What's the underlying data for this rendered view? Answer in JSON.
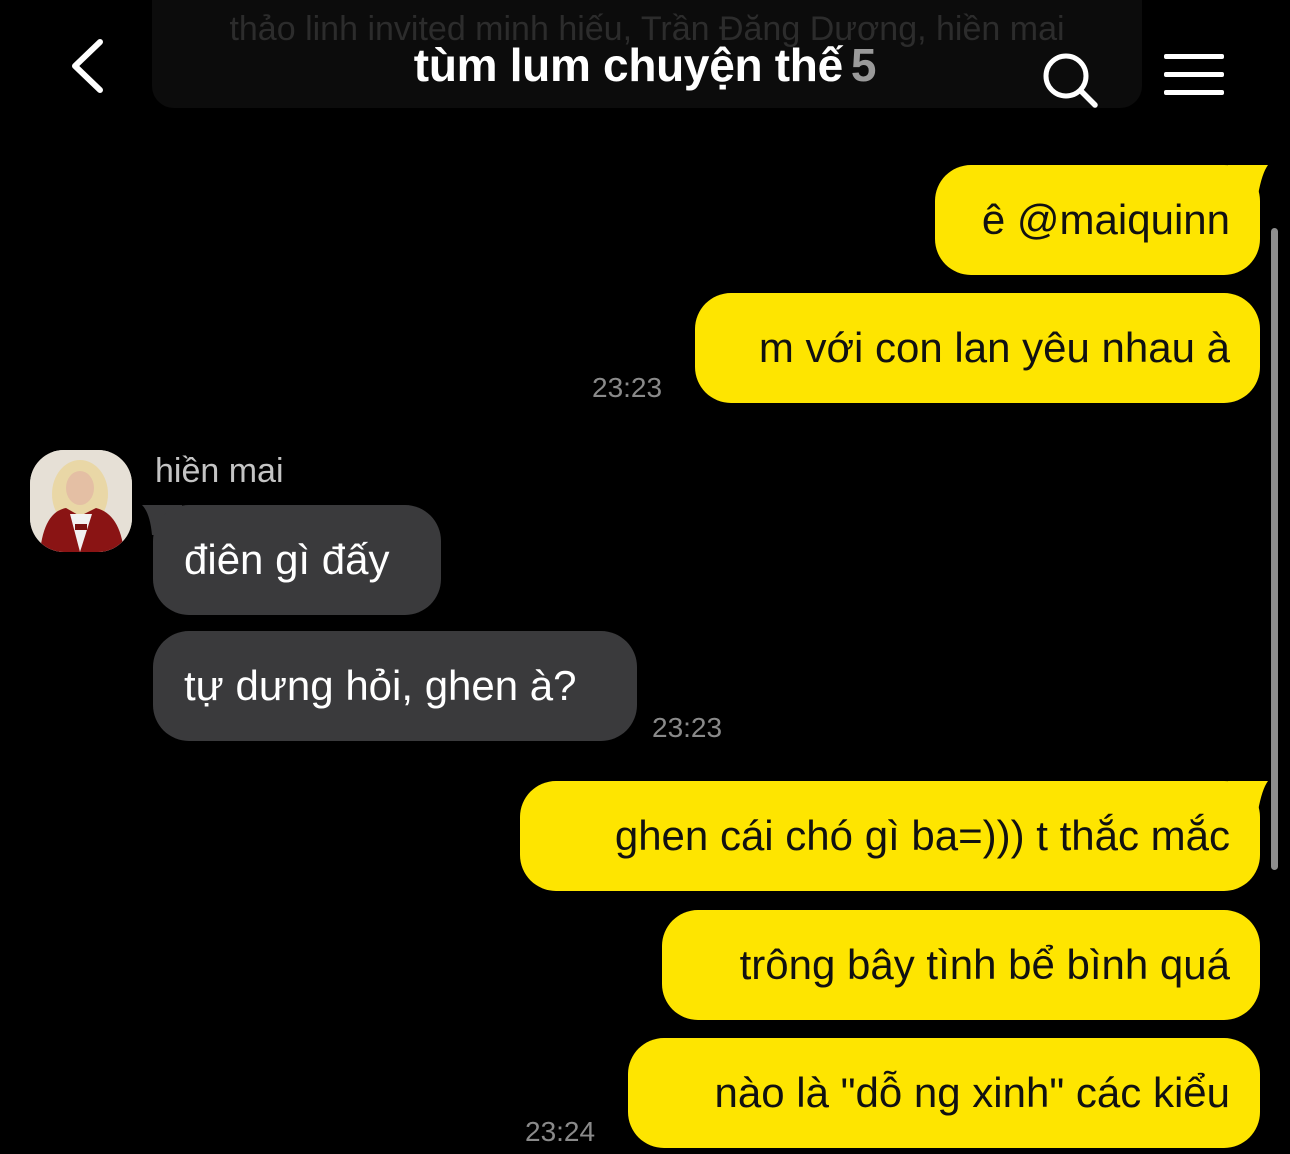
{
  "header": {
    "notice": "thảo linh invited minh hiếu, Trần Đăng Dương, hiền mai",
    "title": "tùm lum chuyện thế",
    "member_count": "5",
    "back_icon": "chevron-left-icon",
    "search_icon": "search-icon",
    "menu_icon": "hamburger-menu-icon"
  },
  "colors": {
    "outgoing_bubble": "#fee500",
    "incoming_bubble": "#3a3a3c",
    "background": "#000000"
  },
  "messages": {
    "m1": "ê @maiquinn",
    "m2": "m với con lan yêu nhau à",
    "t1": "23:23",
    "sender": "hiền mai",
    "m3": "điên gì đấy",
    "m4": "tự dưng hỏi, ghen à?",
    "t2": "23:23",
    "m5": "ghen cái chó gì ba=))) t thắc mắc",
    "m6": "trông bây tình bể bình quá",
    "m7": "nào là \"dỗ ng xinh\" các kiểu",
    "t3": "23:24"
  }
}
